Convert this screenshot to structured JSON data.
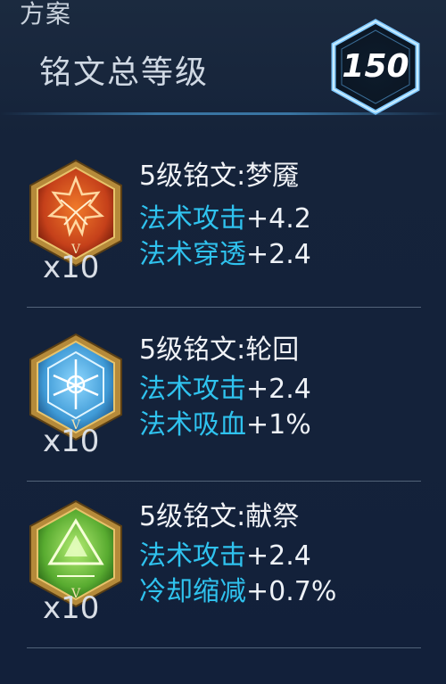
{
  "header": {
    "scheme_fragment": "方案",
    "title": "铭文总等级",
    "total_level": "150"
  },
  "runes": [
    {
      "name": "5级铭文:梦魇",
      "count": "x10",
      "color": "#d0521c",
      "icon": "crimson-rune-icon",
      "stats": [
        {
          "key": "法术攻击",
          "value": "+4.2"
        },
        {
          "key": "法术穿透",
          "value": "+2.4"
        }
      ]
    },
    {
      "name": "5级铭文:轮回",
      "count": "x10",
      "color": "#2e8fd0",
      "icon": "azure-rune-icon",
      "stats": [
        {
          "key": "法术攻击",
          "value": "+2.4"
        },
        {
          "key": "法术吸血",
          "value": "+1%"
        }
      ]
    },
    {
      "name": "5级铭文:献祭",
      "count": "x10",
      "color": "#5fb33a",
      "icon": "emerald-rune-icon",
      "stats": [
        {
          "key": "法术攻击",
          "value": "+2.4"
        },
        {
          "key": "冷却缩减",
          "value": "+0.7%"
        }
      ]
    }
  ]
}
